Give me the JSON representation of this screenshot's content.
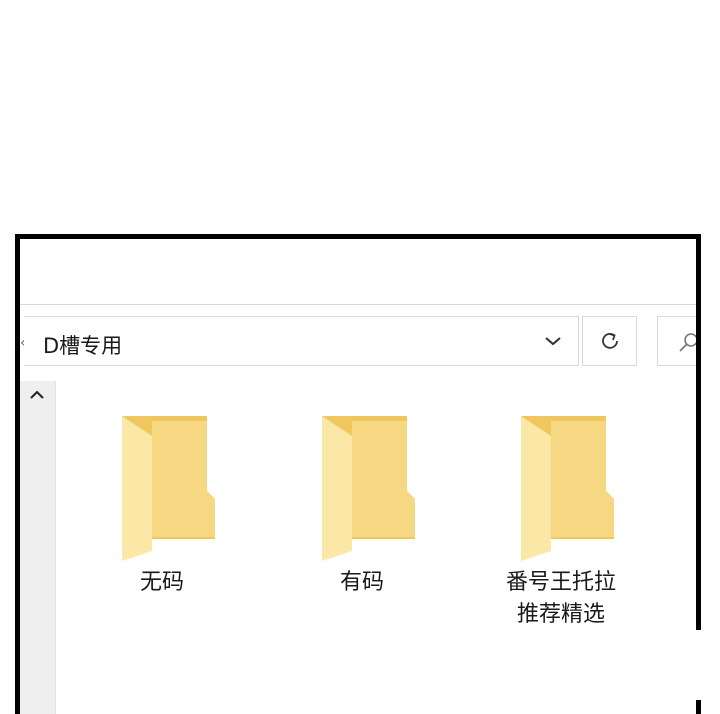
{
  "address_bar": {
    "path": "D槽专用"
  },
  "folders": [
    {
      "name": "无码"
    },
    {
      "name": "有码"
    },
    {
      "name": "番号王托拉\n推荐精选"
    }
  ],
  "colors": {
    "folder_back": "#f0c75e",
    "folder_front": "#f7d882",
    "folder_side": "#fbe7a6"
  },
  "icons": {
    "dropdown": "chevron-down-icon",
    "refresh": "refresh-icon",
    "search": "search-icon",
    "scroll_up": "chevron-up-icon",
    "back": "chevron-left-icon"
  }
}
